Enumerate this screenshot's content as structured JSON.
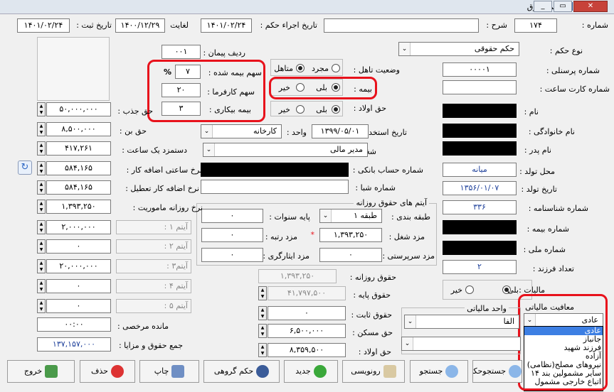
{
  "window": {
    "title": "حکم حقوق",
    "controls": {
      "minimize": "_",
      "restore": "▭",
      "close": "✕"
    }
  },
  "header": {
    "number_label": "شماره :",
    "number": "۱۷۴",
    "desc_label": "شرح :",
    "desc": "",
    "exec_date_label": "تاریخ اجراء حکم :",
    "exec_date": "۱۴۰۱/۰۲/۲۴",
    "until_label": "لغایت",
    "until": "۱۴۰۰/۱۲/۲۹",
    "reg_date_label": "تاریخ ثبت :",
    "reg_date": "۱۴۰۱/۰۲/۲۴"
  },
  "right": {
    "type_label": "نوع حکم :",
    "type": "حکم حقوقی",
    "personnel_label": "شماره پرسنلی :",
    "personnel": "۰۰۰۰۱",
    "card_label": "شماره کارت ساعت :",
    "card": "",
    "name_label": "نام :",
    "family_label": "نام خانوادگی :",
    "father_label": "نام پدر :",
    "birthplace_label": "محل تولد :",
    "birthplace": "میانه",
    "birthdate_label": "تاریخ تولد :",
    "birthdate": "۱۳۵۶/۰۱/۰۷",
    "idno_label": "شماره شناسنامه :",
    "idno": "۳۳۶",
    "insno_label": "شماره بیمه :",
    "national_label": "شماره ملی :",
    "children_label": "تعداد فرزند :",
    "children": "۲",
    "tax_label": "مالیات :",
    "tax_yes": "بلی",
    "tax_no": "خیر",
    "exempt_label": "معافیت مالیاتی",
    "exempt_value": "عادی",
    "exempt_options": [
      "عادی",
      "جانباز",
      "فرزند شهید",
      "آزاده",
      "نیروهای مصلح(نظامی)",
      "سایر مشمولین بند ۱۴",
      "اتباع خارجی مشمول"
    ]
  },
  "middle": {
    "marital_label": "وضعیت تاهل :",
    "single": "مجرد",
    "married": "متاهل",
    "insurance_label": "بیمه :",
    "ins_yes": "بلی",
    "ins_no": "خیر",
    "child_allow_label": "حق اولاد :",
    "ca_yes": "بلی",
    "ca_no": "خیر",
    "hire_date_label": "تاریخ استخدام :",
    "hire_date": "۱۳۹۹/۰۵/۰۱",
    "unit_label": "واحد :",
    "unit": "کارخانه",
    "job_label": "شغل :",
    "job": "مدیر مالی",
    "account_label": "شماره حساب بانکی :",
    "sheba_label": "شماره شبا :",
    "daily_group": "آیتم های حقوق روزانه",
    "grade_label": "طبقه بندی :",
    "grade": "طبقه ۱",
    "base_years_label": "پایه سنوات :",
    "base_years": "۰",
    "job_wage_label": "مزد شغل :",
    "job_wage": "۱,۳۹۳,۲۵۰",
    "rank_wage_label": "مزد رتبه :",
    "rank_wage": "۰",
    "team_wage_label": "مزد سرپرستی :",
    "team_wage": "۰",
    "merit_wage_label": "مزد ایثارگری :",
    "merit_wage": "۰",
    "daily_label": "حقوق روزانه :",
    "daily": "۱,۳۹۳,۲۵۰",
    "base_label": "حقوق پایه :",
    "base": "۴۱,۷۹۷,۵۰۰",
    "fixed_label": "حقوق ثابت :",
    "fixed": "۰",
    "housing_label": "حق مسکن :",
    "housing": "۶,۵۰۰,۰۰۰",
    "child_label": "حق اولاد :",
    "child": "۸,۳۵۹,۵۰۰",
    "tax_unit_label": "واحد مالیاتی",
    "tax_unit": "الفا",
    "required_mark": "*"
  },
  "left": {
    "contract_row_label": "ردیف پیمان :",
    "contract_row": "۰۰۱",
    "ins_share_label": "سهم بیمه شده :",
    "ins_share": "۷",
    "pct": "%",
    "employer_label": "سهم کارفرما :",
    "employer": "۲۰",
    "unemp_label": "بیمه بیکاری :",
    "unemp": "۳",
    "attract_label": "حق جذب :",
    "attract": "۵۰,۰۰۰,۰۰۰",
    "bon_label": "حق بن :",
    "bon": "۸,۵۰۰,۰۰۰",
    "hourly_label": "دستمزد یک ساعت :",
    "hourly": "۴۱۷,۲۶۱",
    "overtime_label": "نرخ ساعتی اضافه کار :",
    "overtime": "۵۸۴,۱۶۵",
    "holiday_label": "نرخ اضافه کار تعطیل :",
    "holiday": "۵۸۴,۱۶۵",
    "mission_label": "نرخ روزانه ماموریت :",
    "mission": "۱,۳۹۳,۲۵۰",
    "item1_label": "آیتم ۱ :",
    "item1": "۲,۰۰۰,۰۰۰",
    "item2_label": "آیتم ۲ :",
    "item2": "۰",
    "item3_label": "آیتم۳ :",
    "item3": "۲۰,۰۰۰,۰۰۰",
    "item4_label": "آیتم ۴ :",
    "item4": "۰",
    "item5_label": "آیتم ۵ :",
    "item5": "۰",
    "leave_label": "مانده مرخصی :",
    "leave": "۰۰:۰۰",
    "total_label": "جمع حقوق و مزایا :",
    "total": "۱۳۷,۱۵۷,۰۰۰"
  },
  "toolbar": {
    "exit": "خروج",
    "delete": "حذف",
    "print": "چاپ",
    "group": "حکم گروهی",
    "new": "جدید",
    "copy": "رونویسی",
    "search": "جستجو",
    "search2": "جستجوحکم"
  },
  "colors": {
    "accent": "#3d7fe3",
    "highlight": "#e8121c"
  }
}
